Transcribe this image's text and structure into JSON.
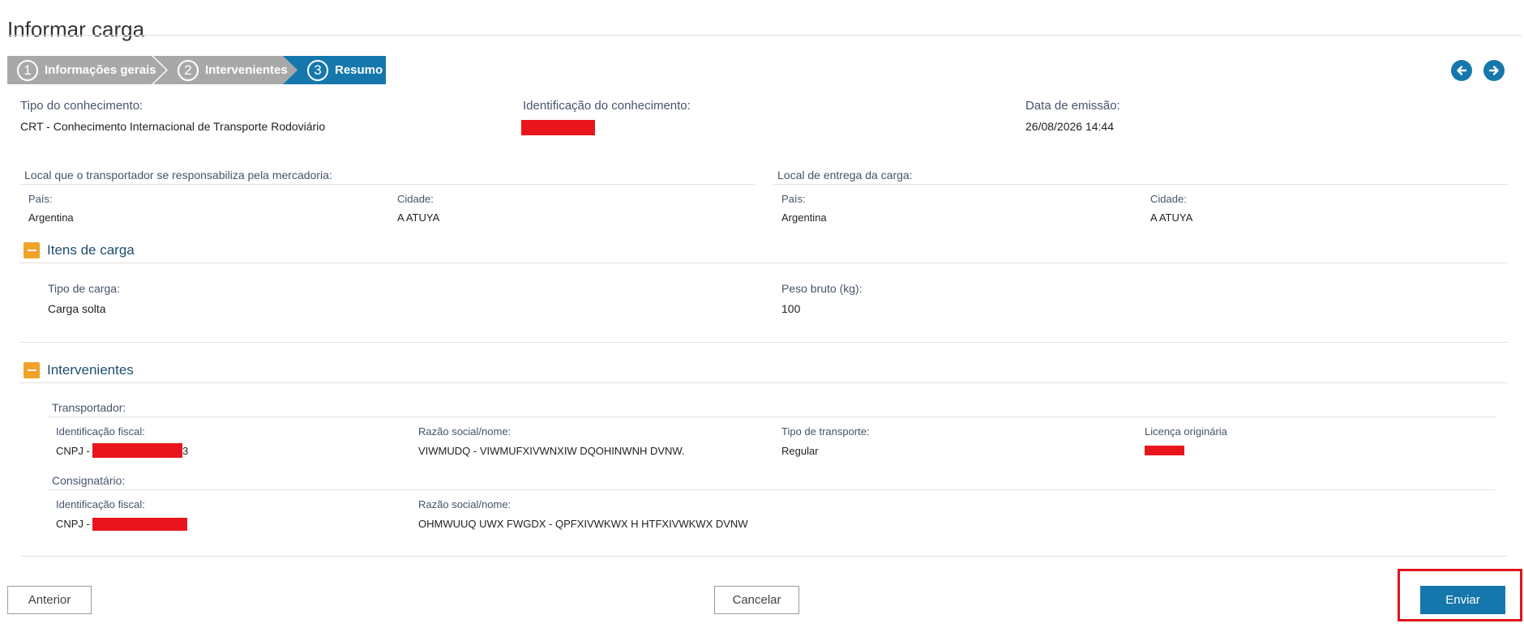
{
  "page": {
    "title": "Informar carga"
  },
  "wizard": {
    "steps": [
      {
        "number": "1",
        "label": "Informações gerais",
        "state": "done"
      },
      {
        "number": "2",
        "label": "Intervenientes",
        "state": "done"
      },
      {
        "number": "3",
        "label": "Resumo",
        "state": "active"
      }
    ]
  },
  "summary": {
    "tipo_label": "Tipo do conhecimento:",
    "tipo_value": "CRT - Conhecimento Internacional de Transporte Rodoviário",
    "identificacao_label": "Identificação do conhecimento:",
    "data_label": "Data de emissão:",
    "data_value": "26/08/2026 14:44"
  },
  "locais": {
    "origem": {
      "header": "Local que o transportador se responsabiliza pela mercadoria:",
      "pais_label": "País:",
      "pais_value": "Argentina",
      "cidade_label": "Cidade:",
      "cidade_value": "A ATUYA"
    },
    "entrega": {
      "header": "Local de entrega da carga:",
      "pais_label": "País:",
      "pais_value": "Argentina",
      "cidade_label": "Cidade:",
      "cidade_value": "A ATUYA"
    }
  },
  "itens": {
    "title": "Itens de carga",
    "tipo_label": "Tipo de carga:",
    "tipo_value": "Carga solta",
    "peso_label": "Peso bruto (kg):",
    "peso_value": "100"
  },
  "intervenientes": {
    "title": "Intervenientes",
    "transportador": {
      "header": "Transportador:",
      "fiscal_label": "Identificação fiscal:",
      "fiscal_prefix": "CNPJ - 0",
      "fiscal_suffix": "3",
      "razao_label": "Razão social/nome:",
      "razao_value": "VIWMUDQ - VIWMUFXIVWNXIW DQOHINWNH DVNW.",
      "tipo_label": "Tipo de transporte:",
      "tipo_value": "Regular",
      "licenca_label": "Licença originária"
    },
    "consignatario": {
      "header": "Consignatário:",
      "fiscal_label": "Identificação fiscal:",
      "fiscal_prefix": "CNPJ - 0",
      "razao_label": "Razão social/nome:",
      "razao_value": "OHMWUUQ UWX FWGDX - QPFXIVWKWX H HTFXIVWKWX DVNW"
    }
  },
  "buttons": {
    "anterior": "Anterior",
    "cancelar": "Cancelar",
    "enviar": "Enviar"
  },
  "colors": {
    "primary": "#1577ac",
    "accent": "#f0a229",
    "step_inactive": "#a8a8a8",
    "redaction": "#e8161c"
  },
  "icons": {
    "prev": "arrow-left-circle-icon",
    "next": "arrow-right-circle-icon",
    "collapse": "minus-icon"
  }
}
